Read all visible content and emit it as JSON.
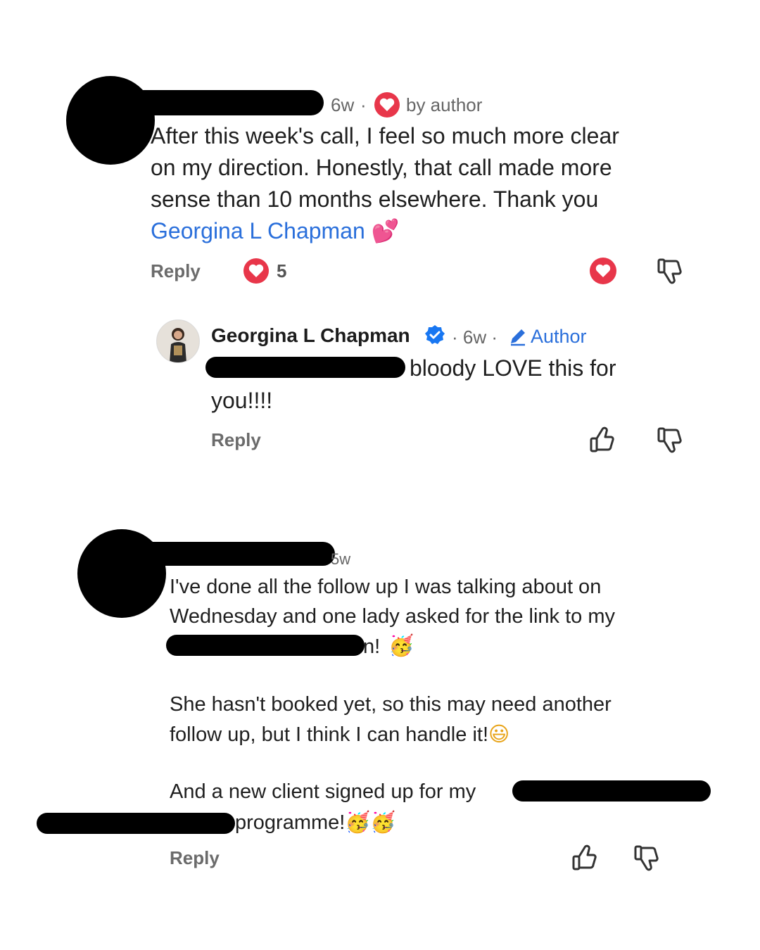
{
  "comments": [
    {
      "time": "6w",
      "liked_by_author_label": "by author",
      "text_lines": [
        "After this week's call, I feel so much more clear",
        "on my direction. Honestly, that call made more",
        "sense than 10 months elsewhere. Thank you"
      ],
      "mention": "Georgina L Chapman",
      "mention_emoji": "💕",
      "reply_label": "Reply",
      "like_count": "5"
    },
    {
      "time": "5w",
      "text_lines": [
        "I've done all the follow up I was talking about on",
        "Wednesday and one lady asked for the link to my"
      ],
      "line3_tail": "n!",
      "line3_emoji": "🥳",
      "para2_lines": [
        "She hasn't booked yet, so this may need another",
        "follow up, but I think I can handle it!"
      ],
      "para2_emoji": "😃",
      "para3_line1": "And a new client signed up for my",
      "para3_line2_tail": "programme!",
      "para3_emoji": "🥳🥳",
      "reply_label": "Reply"
    }
  ],
  "reply": {
    "author_name": "Georgina L Chapman",
    "time": "· 6w ·",
    "author_badge": "Author",
    "text_tail": "bloody LOVE this for",
    "text_line2": "you!!!!",
    "reply_label": "Reply"
  },
  "colors": {
    "heart_red": "#e8364a",
    "link_blue": "#2a6fdb",
    "verified_blue": "#1877f2"
  }
}
